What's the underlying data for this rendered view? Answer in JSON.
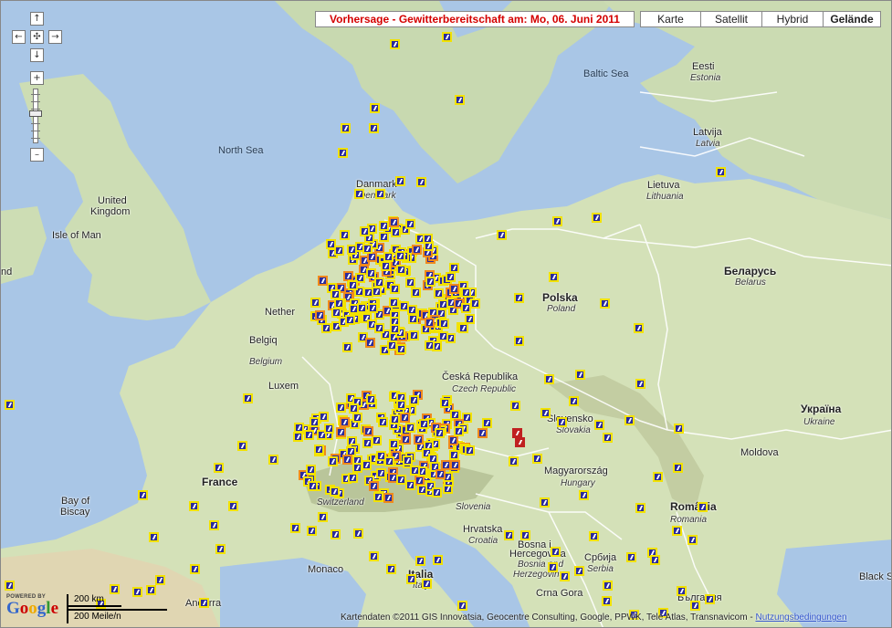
{
  "forecast_title": "Vorhersage - Gewitterbereitschaft am: Mo, 06. Juni 2011",
  "map_types": [
    "Karte",
    "Satellit",
    "Hybrid",
    "Gelände"
  ],
  "active_map_type": "Gelände",
  "controls": {
    "pan_up": "↑",
    "pan_left": "←",
    "pan_center": "✣",
    "pan_right": "→",
    "pan_down": "↓",
    "zoom_in": "+",
    "zoom_out": "–"
  },
  "labels": {
    "baltic_sea": "Baltic Sea",
    "north_sea": "North Sea",
    "eesti": "Eesti",
    "estonia": "Estonia",
    "latvija": "Latvija",
    "latvia": "Latvia",
    "lietuva": "Lietuva",
    "lithuania": "Lithuania",
    "danmark": "Danmark",
    "denmark": "Denmark",
    "united_kingdom": "United Kingdom",
    "isle_of_man": "Isle of Man",
    "nd": "nd",
    "belarus": "Беларусь",
    "belarus_sub": "Belarus",
    "polska": "Polska",
    "poland": "Poland",
    "nether": "Nether",
    "belgie": "Belgiq",
    "belgium": "Belgium",
    "luxem": "Luxem",
    "czech": "Česká Republika",
    "czech_sub": "Czech Republic",
    "slovensko": "Slovensko",
    "slovakia": "Slovakia",
    "ukraina": "Україна",
    "ukraine": "Ukraine",
    "moldova": "Moldova",
    "magyarorszag": "Magyarország",
    "hungary": "Hungary",
    "france": "France",
    "switzerland": "Switzerland",
    "slovenia": "Slovenia",
    "romania": "România",
    "romania_sub": "Romania",
    "bay_of_biscay_1": "Bay of",
    "bay_of_biscay_2": "Biscay",
    "hrvatska": "Hrvatska",
    "croatia": "Croatia",
    "bih1": "Bosna i",
    "bih2": "Hercegovina",
    "bih3": "Bosnia and",
    "bih4": "Herzegovina",
    "srbija": "Србија",
    "serbia": "Serbia",
    "monaco": "Monaco",
    "italia": "Italia",
    "italy": "Italy",
    "andorra": "Andorra",
    "crna_gora": "Crna Gora",
    "bulgaria": "България",
    "black_sea": "Black S"
  },
  "google": {
    "powered": "POWERED BY",
    "logo": "Google"
  },
  "scale": {
    "km": "200 km",
    "mi": "200 Meile/n"
  },
  "attribution": {
    "text": "Kartendaten ©2011 GIS Innovatsia, Geocentre Consulting, Google, PPWK, Tele Atlas, Transnavicom - ",
    "link": "Nutzungsbedingungen"
  },
  "marker_counts": {
    "total_visible": 500
  }
}
